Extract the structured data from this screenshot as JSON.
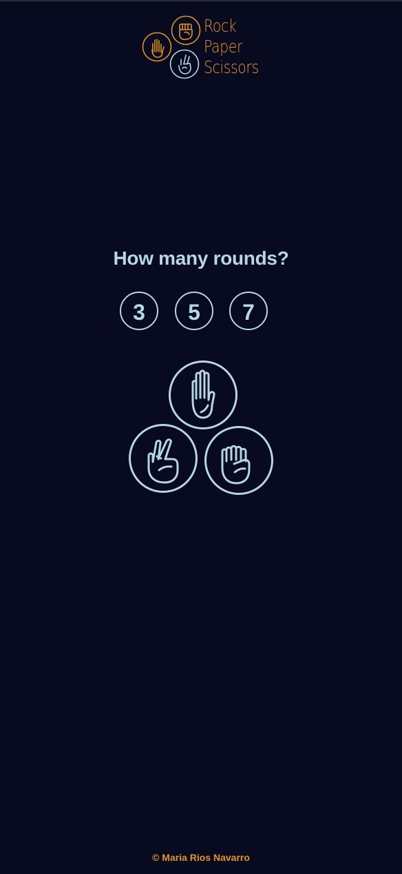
{
  "logo": {
    "words": [
      "Rock",
      "Paper",
      "Scissors"
    ],
    "icons": [
      "paper-hand-icon",
      "rock-fist-icon",
      "scissors-hand-icon"
    ]
  },
  "question": "How many rounds?",
  "round_options": [
    "3",
    "5",
    "7"
  ],
  "hands": [
    {
      "name": "paper",
      "icon": "paper-hand-icon"
    },
    {
      "name": "scissors",
      "icon": "scissors-hand-icon"
    },
    {
      "name": "rock",
      "icon": "rock-fist-icon"
    }
  ],
  "footer": "© Maria Rios Navarro",
  "colors": {
    "background": "#080a20",
    "accent": "#e0952a",
    "primary": "#b6d6e6"
  }
}
